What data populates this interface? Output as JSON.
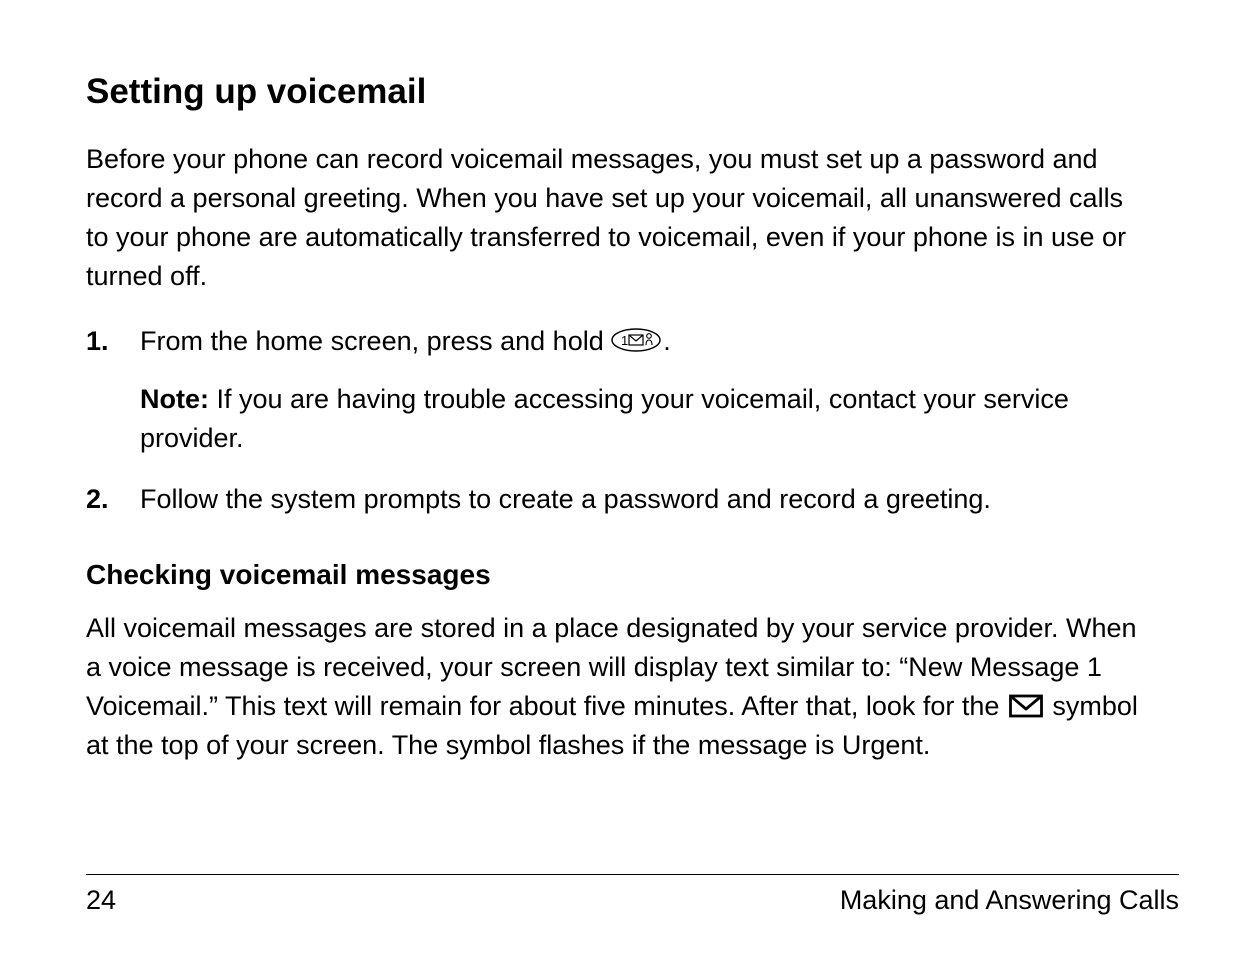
{
  "heading": "Setting up voicemail",
  "intro": "Before your phone can record voicemail messages, you must set up a password and record a personal greeting. When you have set up your voicemail, all unanswered calls to your phone are automatically transferred to voicemail, even if your phone is in use or turned off.",
  "steps": [
    {
      "num": "1.",
      "text_before_icon": "From the home screen, press and hold ",
      "text_after_icon": ".",
      "note_label": "Note:",
      "note_text": " If you are having trouble accessing your voicemail, contact your service provider."
    },
    {
      "num": "2.",
      "text": "Follow the system prompts to create a password and record a greeting."
    }
  ],
  "subheading": "Checking voicemail messages",
  "para2_before": "All voicemail messages are stored in a place designated by your service provider. When a voice message is received, your screen will display text similar to: “New Message 1 Voicemail.” This text will remain for about five minutes. After that, look for the ",
  "para2_after": " symbol at the top of your screen. The symbol flashes if the message is Urgent.",
  "footer": {
    "page_number": "24",
    "section": "Making and Answering Calls"
  }
}
